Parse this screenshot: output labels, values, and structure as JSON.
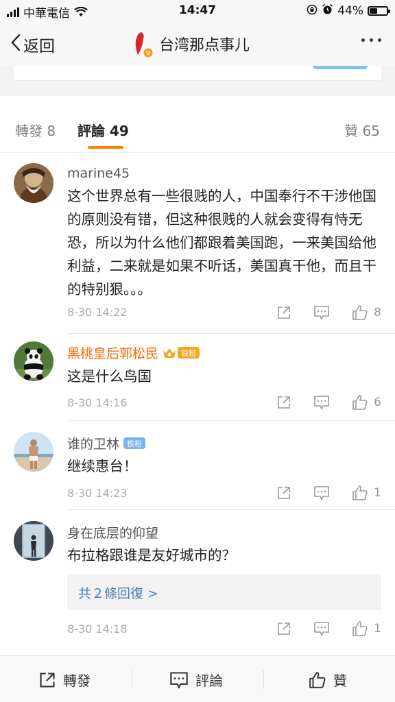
{
  "status_bar": {
    "carrier": "中華電信",
    "time": "14:47",
    "battery_percent": "44%",
    "battery_level": 0.44
  },
  "nav": {
    "back_label": "返回",
    "title": "台湾那点事儿",
    "logo_caption": "台湾那点事儿"
  },
  "tabs": {
    "repost": "轉發 8",
    "comments": "評論 49",
    "likes": "贊 65"
  },
  "comments": [
    {
      "user": "marine45",
      "text": "这个世界总有一些很贱的人，中国奉行不干涉他国的原则没有错，但这种很贱的人就会变得有恃无恐，所以为什么他们都跟着美国跑，一来美国给他利益，二来就是如果不听话，美国真干他，而且干的特别狠。。。",
      "time": "8-30 14:22",
      "likes": "8"
    },
    {
      "user": "黑桃皇后郭松民",
      "badge": "铁粉",
      "text": "这是什么鸟国",
      "time": "8-30 14:16",
      "likes": "6"
    },
    {
      "user": "谁的卫林",
      "badge": "铁粉",
      "text": "继续惠台！",
      "time": "8-30 14:23",
      "likes": "1"
    },
    {
      "user": "身在底层的仰望",
      "text": "布拉格跟谁是友好城市的？",
      "replies": "共２條回復 >",
      "time": "8-30 14:18",
      "likes": "1"
    }
  ],
  "bottom_bar": {
    "repost": "轉發",
    "comment": "評論",
    "like": "贊"
  },
  "colors": {
    "accent_orange": "#ff8200",
    "vip_name": "#ff6a00",
    "link_blue": "#4a7fbf",
    "fan_badge_gold": "#f5a623",
    "fan_badge_blue": "#7bb3ee"
  }
}
